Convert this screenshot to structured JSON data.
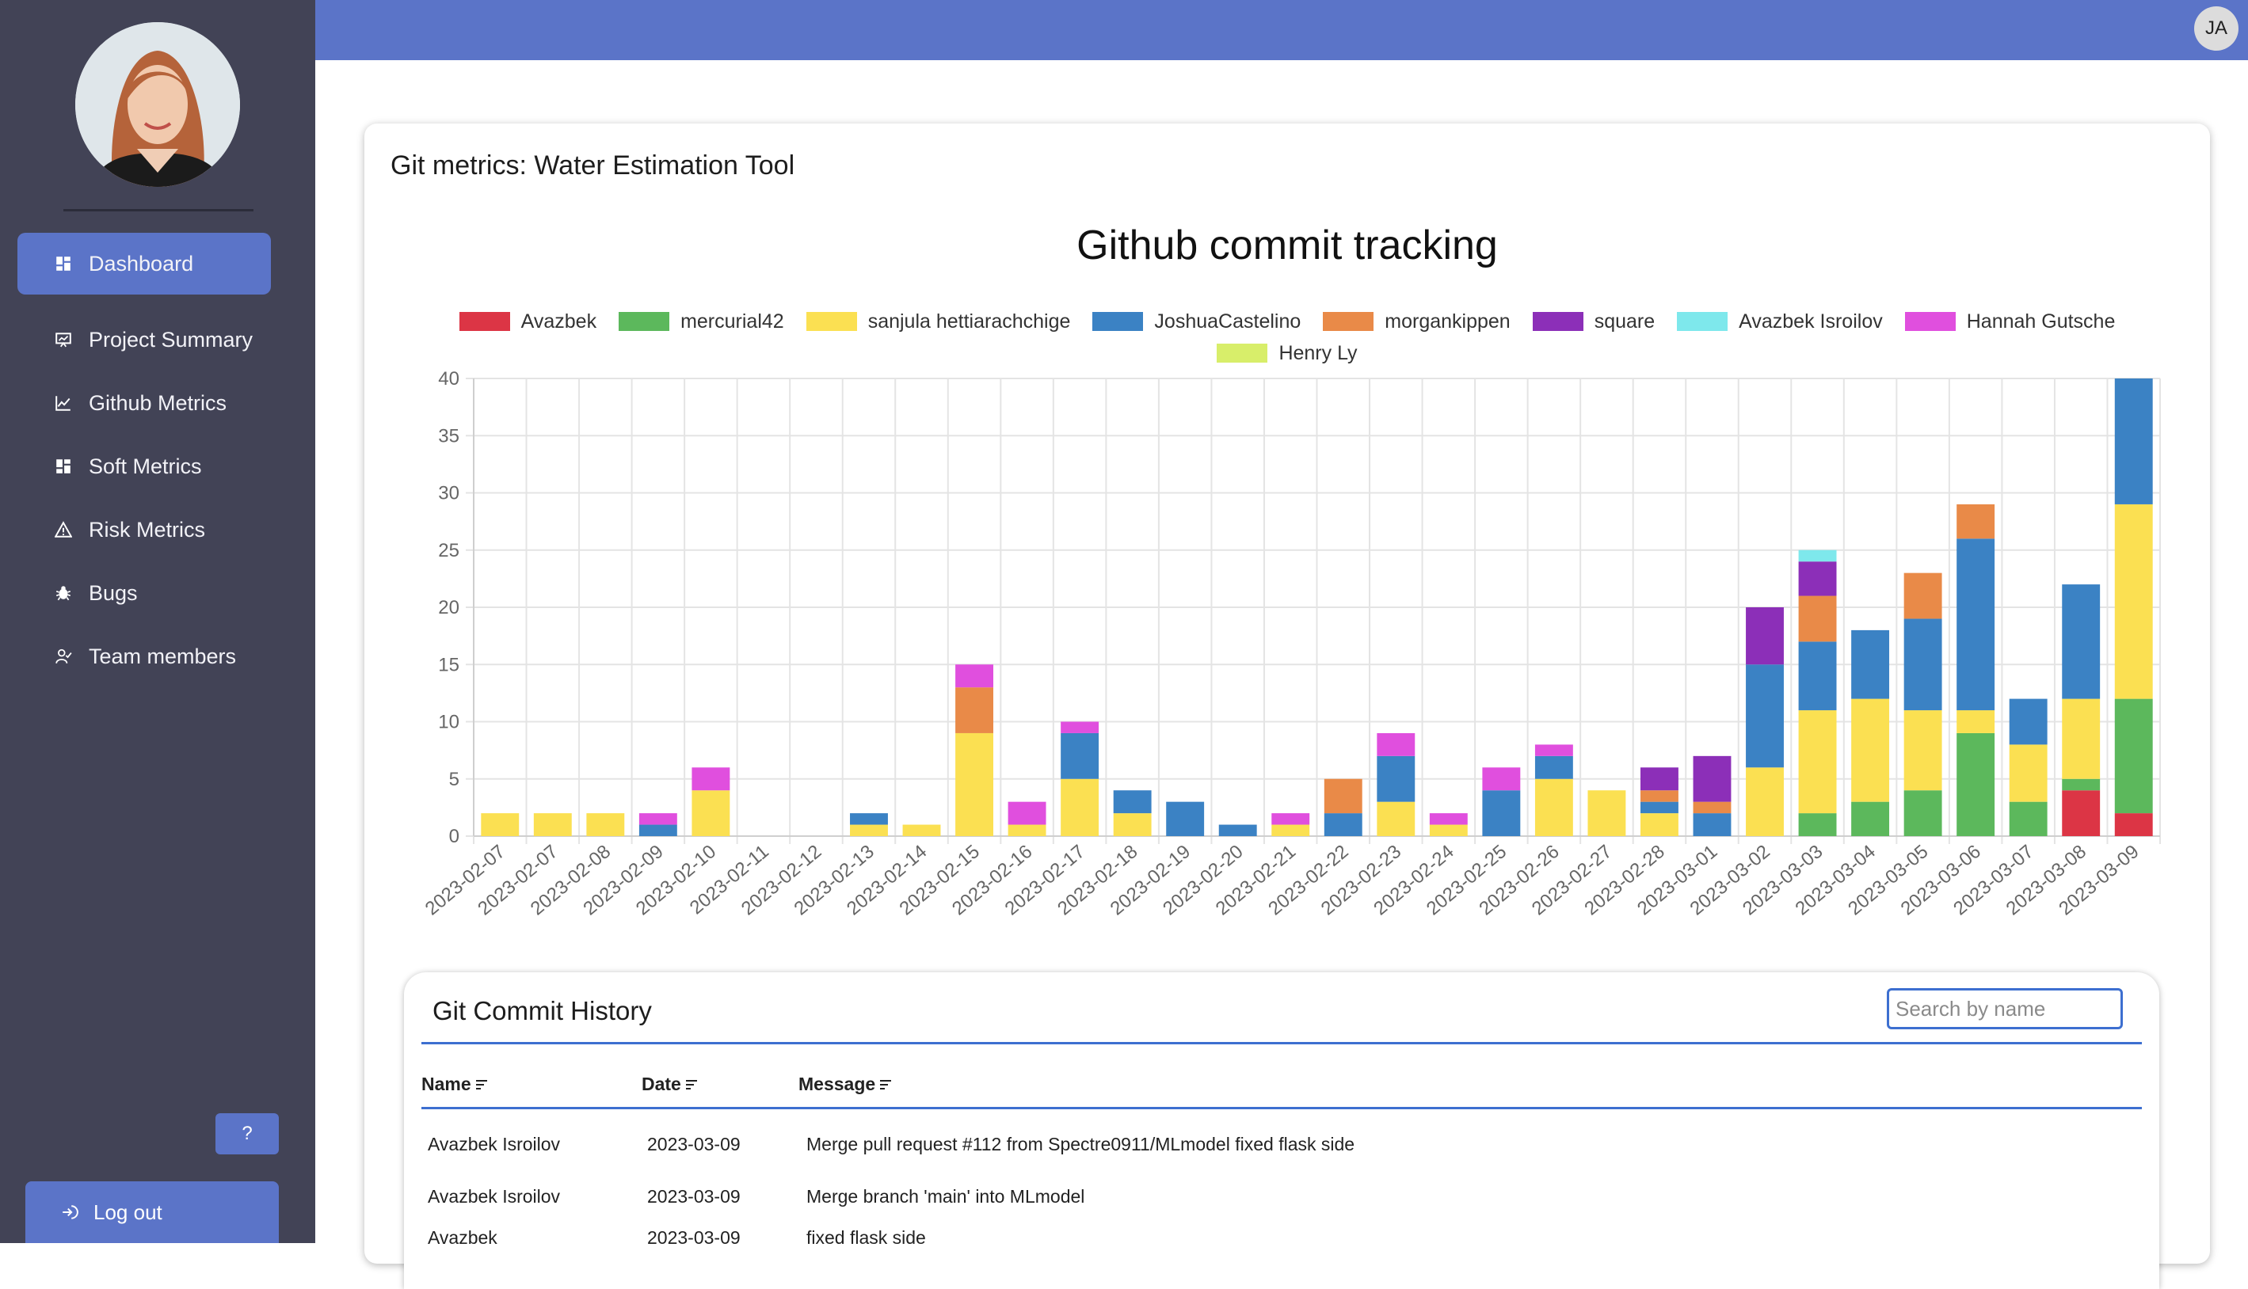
{
  "sidebar": {
    "items": [
      {
        "label": "Dashboard",
        "icon": "dashboard-icon",
        "active": true
      },
      {
        "label": "Project Summary",
        "icon": "presentation-icon",
        "active": false
      },
      {
        "label": "Github Metrics",
        "icon": "line-chart-icon",
        "active": false
      },
      {
        "label": "Soft Metrics",
        "icon": "grid-icon",
        "active": false
      },
      {
        "label": "Risk Metrics",
        "icon": "warning-icon",
        "active": false
      },
      {
        "label": "Bugs",
        "icon": "bug-icon",
        "active": false
      },
      {
        "label": "Team members",
        "icon": "team-icon",
        "active": false
      }
    ],
    "help_label": "?",
    "logout_label": "Log out"
  },
  "topbar": {
    "user_initials": "JA"
  },
  "card": {
    "title": "Git metrics: Water Estimation Tool"
  },
  "chart_data": {
    "type": "bar",
    "stacked": true,
    "title": "Github commit tracking",
    "xlabel": "",
    "ylabel": "",
    "ylim": [
      0,
      40
    ],
    "yticks": [
      0,
      5,
      10,
      15,
      20,
      25,
      30,
      35,
      40
    ],
    "grid": true,
    "legend_position": "top",
    "categories": [
      "2023-02-07",
      "2023-02-07",
      "2023-02-08",
      "2023-02-09",
      "2023-02-10",
      "2023-02-11",
      "2023-02-12",
      "2023-02-13",
      "2023-02-14",
      "2023-02-15",
      "2023-02-16",
      "2023-02-17",
      "2023-02-18",
      "2023-02-19",
      "2023-02-20",
      "2023-02-21",
      "2023-02-22",
      "2023-02-23",
      "2023-02-24",
      "2023-02-25",
      "2023-02-26",
      "2023-02-27",
      "2023-02-28",
      "2023-03-01",
      "2023-03-02",
      "2023-03-03",
      "2023-03-04",
      "2023-03-05",
      "2023-03-06",
      "2023-03-07",
      "2023-03-08",
      "2023-03-09"
    ],
    "series": [
      {
        "name": "Avazbek",
        "color": "#dc3545",
        "values": [
          0,
          0,
          0,
          0,
          0,
          0,
          0,
          0,
          0,
          0,
          0,
          0,
          0,
          0,
          0,
          0,
          0,
          0,
          0,
          0,
          0,
          0,
          0,
          0,
          0,
          0,
          0,
          0,
          0,
          0,
          4,
          2
        ]
      },
      {
        "name": "mercurial42",
        "color": "#5cb85c",
        "values": [
          0,
          0,
          0,
          0,
          0,
          0,
          0,
          0,
          0,
          0,
          0,
          0,
          0,
          0,
          0,
          0,
          0,
          0,
          0,
          0,
          0,
          0,
          0,
          0,
          0,
          2,
          3,
          4,
          9,
          3,
          1,
          10
        ]
      },
      {
        "name": "sanjula hettiarachchige",
        "color": "#fbe052",
        "values": [
          2,
          2,
          2,
          0,
          4,
          0,
          0,
          1,
          1,
          9,
          1,
          5,
          2,
          0,
          0,
          1,
          0,
          3,
          1,
          0,
          5,
          4,
          2,
          0,
          6,
          9,
          9,
          7,
          2,
          5,
          7,
          17
        ]
      },
      {
        "name": "JoshuaCastelino",
        "color": "#3b82c4",
        "values": [
          0,
          0,
          0,
          1,
          0,
          0,
          0,
          1,
          0,
          0,
          0,
          4,
          2,
          3,
          1,
          0,
          2,
          4,
          0,
          4,
          2,
          0,
          1,
          2,
          9,
          6,
          6,
          8,
          15,
          4,
          10,
          11
        ]
      },
      {
        "name": "morgankippen",
        "color": "#e98a48",
        "values": [
          0,
          0,
          0,
          0,
          0,
          0,
          0,
          0,
          0,
          4,
          0,
          0,
          0,
          0,
          0,
          0,
          3,
          0,
          0,
          0,
          0,
          0,
          1,
          1,
          0,
          4,
          0,
          4,
          3,
          0,
          0,
          0
        ]
      },
      {
        "name": "square",
        "color": "#8c2fb8",
        "values": [
          0,
          0,
          0,
          0,
          0,
          0,
          0,
          0,
          0,
          0,
          0,
          0,
          0,
          0,
          0,
          0,
          0,
          0,
          0,
          0,
          0,
          0,
          2,
          4,
          5,
          3,
          0,
          0,
          0,
          0,
          0,
          0
        ]
      },
      {
        "name": "Avazbek Isroilov",
        "color": "#7ee8ec",
        "values": [
          0,
          0,
          0,
          0,
          0,
          0,
          0,
          0,
          0,
          0,
          0,
          0,
          0,
          0,
          0,
          0,
          0,
          0,
          0,
          0,
          0,
          0,
          0,
          0,
          0,
          1,
          0,
          0,
          0,
          0,
          0,
          0
        ]
      },
      {
        "name": "Hannah Gutsche",
        "color": "#e04fde",
        "values": [
          0,
          0,
          0,
          1,
          2,
          0,
          0,
          0,
          0,
          2,
          2,
          1,
          0,
          0,
          0,
          1,
          0,
          2,
          1,
          2,
          1,
          0,
          0,
          0,
          0,
          0,
          0,
          0,
          0,
          0,
          0,
          0
        ]
      },
      {
        "name": "Henry Ly",
        "color": "#d8ee6a",
        "values": [
          0,
          0,
          0,
          0,
          0,
          0,
          0,
          0,
          0,
          0,
          0,
          0,
          0,
          0,
          0,
          0,
          0,
          0,
          0,
          0,
          0,
          0,
          0,
          0,
          0,
          0,
          0,
          0,
          0,
          0,
          0,
          0
        ]
      }
    ]
  },
  "history": {
    "title": "Git Commit History",
    "search_placeholder": "Search by name",
    "columns": [
      "Name",
      "Date",
      "Message"
    ],
    "rows": [
      {
        "name": "Avazbek Isroilov",
        "date": "2023-03-09",
        "message": "Merge pull request #112 from Spectre0911/MLmodel fixed flask side"
      },
      {
        "name": "Avazbek Isroilov",
        "date": "2023-03-09",
        "message": "Merge branch 'main' into MLmodel"
      },
      {
        "name": "Avazbek",
        "date": "2023-03-09",
        "message": "fixed flask side"
      }
    ]
  }
}
